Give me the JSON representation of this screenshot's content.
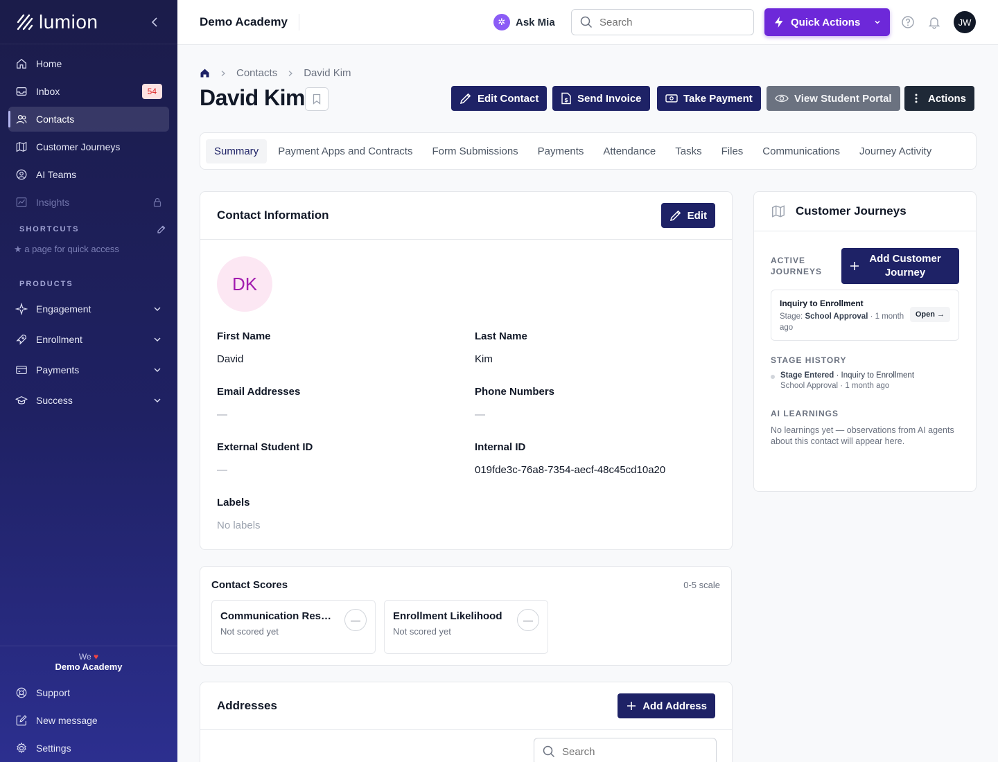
{
  "sidebar": {
    "brand": "lumion",
    "nav": [
      {
        "label": "Home",
        "icon": "home-icon"
      },
      {
        "label": "Inbox",
        "icon": "inbox-icon",
        "badge": "54"
      },
      {
        "label": "Contacts",
        "icon": "contacts-icon",
        "active": true
      },
      {
        "label": "Customer Journeys",
        "icon": "map-icon"
      },
      {
        "label": "AI Teams",
        "icon": "user-circle-icon"
      },
      {
        "label": "Insights",
        "icon": "chart-icon",
        "locked": true
      }
    ],
    "shortcuts_label": "SHORTCUTS",
    "shortcuts_hint": "★ a page for quick access",
    "products_label": "PRODUCTS",
    "products": [
      {
        "label": "Engagement",
        "icon": "sparkle-icon"
      },
      {
        "label": "Enrollment",
        "icon": "rocket-icon"
      },
      {
        "label": "Payments",
        "icon": "card-icon"
      },
      {
        "label": "Success",
        "icon": "graduation-icon"
      }
    ],
    "footer": {
      "we": "We",
      "academy": "Demo Academy",
      "items": [
        {
          "label": "Support",
          "icon": "support-icon"
        },
        {
          "label": "New message",
          "icon": "compose-icon"
        },
        {
          "label": "Settings",
          "icon": "gear-icon"
        }
      ]
    }
  },
  "topbar": {
    "org_name": "Demo Academy",
    "ask_mia": "Ask Mia",
    "search_placeholder": "Search",
    "quick_actions": "Quick Actions",
    "avatar_initials": "JW"
  },
  "breadcrumb": {
    "items": [
      "Contacts",
      "David Kim"
    ]
  },
  "page": {
    "title": "David Kim",
    "actions": {
      "edit_contact": "Edit Contact",
      "send_invoice": "Send Invoice",
      "take_payment": "Take Payment",
      "view_portal": "View Student Portal",
      "more": "Actions"
    }
  },
  "tabs": [
    "Summary",
    "Payment Apps and Contracts",
    "Form Submissions",
    "Payments",
    "Attendance",
    "Tasks",
    "Files",
    "Communications",
    "Journey Activity"
  ],
  "contact_info": {
    "title": "Contact Information",
    "edit": "Edit",
    "initials": "DK",
    "fields": {
      "first_name": {
        "label": "First Name",
        "value": "David"
      },
      "last_name": {
        "label": "Last Name",
        "value": "Kim"
      },
      "emails": {
        "label": "Email Addresses",
        "value": "—"
      },
      "phones": {
        "label": "Phone Numbers",
        "value": "—"
      },
      "external_id": {
        "label": "External Student ID",
        "value": "—"
      },
      "internal_id": {
        "label": "Internal ID",
        "value": "019fde3c-76a8-7354-aecf-48c45cd10a20"
      },
      "labels": {
        "label": "Labels",
        "value": "No labels"
      }
    }
  },
  "scores": {
    "title": "Contact Scores",
    "scale": "0-5 scale",
    "items": [
      {
        "name": "Communication Responsiveness",
        "status": "Not scored yet",
        "score": "—"
      },
      {
        "name": "Enrollment Likelihood",
        "status": "Not scored yet",
        "score": "—"
      }
    ]
  },
  "addresses": {
    "title": "Addresses",
    "add": "Add Address",
    "search_placeholder": "Search"
  },
  "journeys": {
    "title": "Customer Journeys",
    "active_label": "ACTIVE JOURNEYS",
    "add": "Add Customer Journey",
    "journey": {
      "name": "Inquiry to Enrollment",
      "stage_prefix": "Stage:",
      "stage": "School Approval",
      "time": "· 1 month ago",
      "open": "Open →"
    },
    "history_label": "STAGE HISTORY",
    "history": {
      "event": "Stage Entered",
      "journey": "· Inquiry to Enrollment",
      "detail": "School Approval · 1 month ago"
    },
    "learnings_label": "AI LEARNINGS",
    "learnings_text": "No learnings yet — observations from AI agents about this contact will appear here."
  }
}
